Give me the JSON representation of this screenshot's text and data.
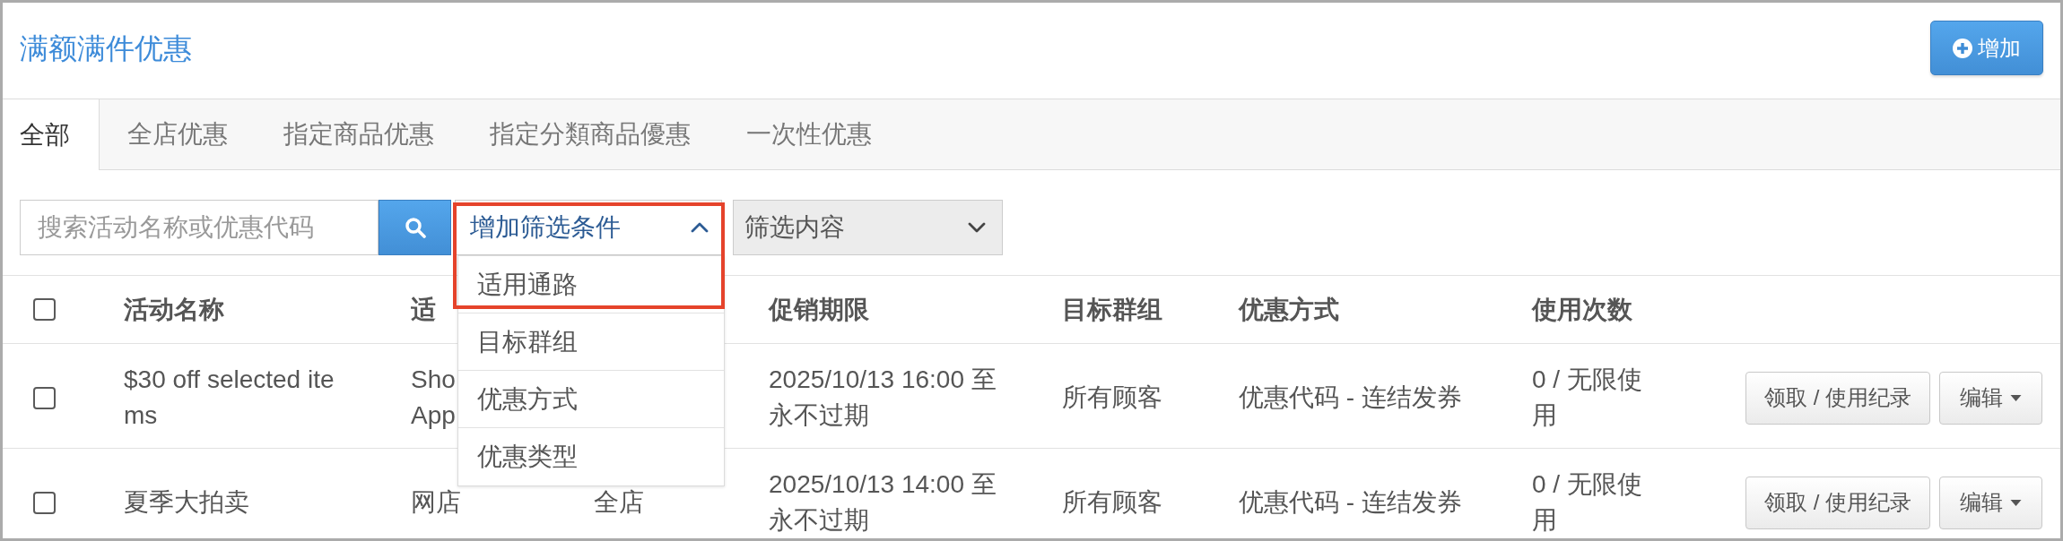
{
  "header": {
    "title": "满额满件优惠",
    "add_button": "增加"
  },
  "tabs": [
    {
      "label": "全部",
      "selected": true
    },
    {
      "label": "全店优惠",
      "selected": false
    },
    {
      "label": "指定商品优惠",
      "selected": false
    },
    {
      "label": "指定分類商品優惠",
      "selected": false
    },
    {
      "label": "一次性优惠",
      "selected": false
    }
  ],
  "toolbar": {
    "search": {
      "placeholder": "搜索活动名称或优惠代码"
    },
    "filter_dropdown": {
      "label": "增加筛选条件",
      "expanded": true,
      "highlighted": true,
      "options": [
        "适用通路",
        "目标群组",
        "优惠方式",
        "优惠类型"
      ]
    },
    "filter_value": {
      "label": "筛选内容"
    }
  },
  "table": {
    "select_all_checked": false,
    "columns": [
      "活动名称",
      "适",
      null,
      "促销期限",
      "目标群组",
      "优惠方式",
      "使用次数"
    ],
    "rows": [
      {
        "checked": false,
        "cells": [
          "$30 off selected items",
          "Sho App",
          null,
          "2025/10/13 16:00 至永不过期",
          "所有顾客",
          "优惠代码 - 连结发券",
          "0 / 无限使用"
        ],
        "actions": [
          {
            "kind": "button",
            "label": "领取 / 使用纪录"
          },
          {
            "kind": "dropdown",
            "label": "编辑"
          }
        ]
      },
      {
        "checked": false,
        "cells": [
          "夏季大拍卖",
          "网店",
          "全店",
          "2025/10/13 14:00 至永不过期",
          "所有顾客",
          "优惠代码 - 连结发券",
          "0 / 无限使用"
        ],
        "actions": [
          {
            "kind": "button",
            "label": "领取 / 使用纪录"
          },
          {
            "kind": "dropdown",
            "label": "编辑"
          }
        ]
      }
    ]
  }
}
